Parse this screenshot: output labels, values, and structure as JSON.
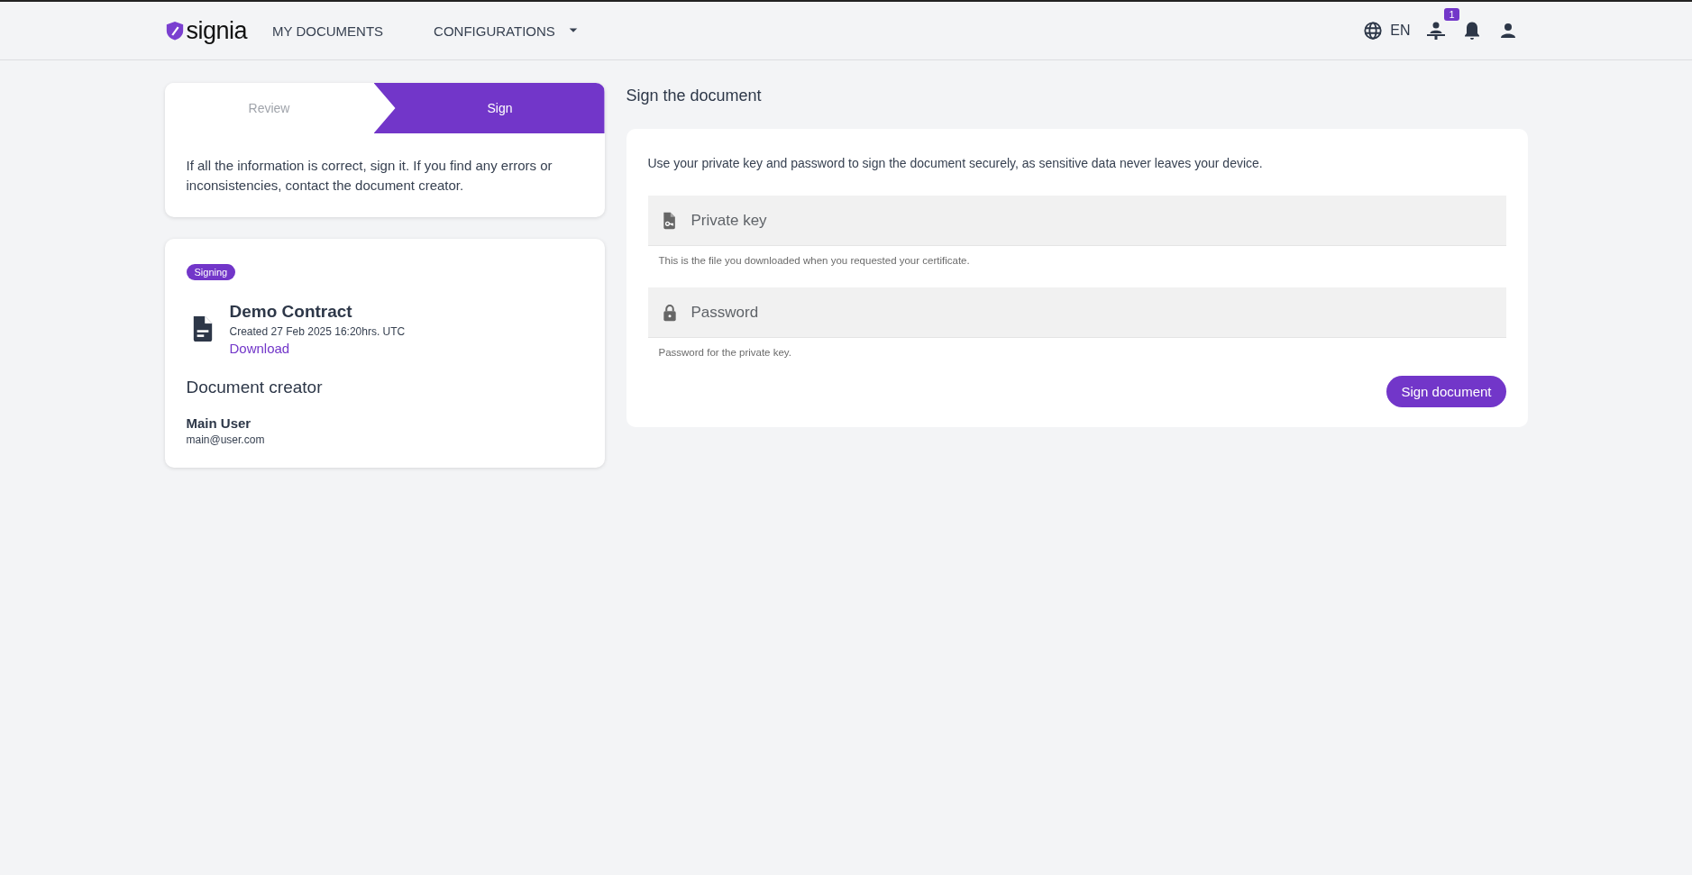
{
  "header": {
    "logo": "signia",
    "nav": [
      {
        "label": "MY DOCUMENTS",
        "kind": "link"
      },
      {
        "label": "CONFIGURATIONS",
        "kind": "dropdown"
      }
    ],
    "language": "EN",
    "badge": "1"
  },
  "steps": [
    {
      "label": "Review",
      "selected": false
    },
    {
      "label": "Sign",
      "selected": true
    }
  ],
  "instructions": "If all the information is correct, sign it. If you find any errors or inconsistencies, contact the document creator.",
  "document": {
    "status": "Signing",
    "name": "Demo Contract",
    "created": "Created 27 Feb 2025 16:20hrs. UTC",
    "download": "Download"
  },
  "creator": {
    "heading": "Document creator",
    "name": "Main User",
    "email": "main@user.com"
  },
  "sign": {
    "title": "Sign the document",
    "description": "Use your private key and password to sign the document securely, as sensitive data never leaves your device.",
    "fields": [
      {
        "kind": "file",
        "placeholder": "Private key",
        "hint": "This is the file you downloaded when you requested your certificate."
      },
      {
        "kind": "password",
        "placeholder": "Password",
        "hint": "Password for the private key."
      }
    ],
    "button": "Sign document"
  }
}
